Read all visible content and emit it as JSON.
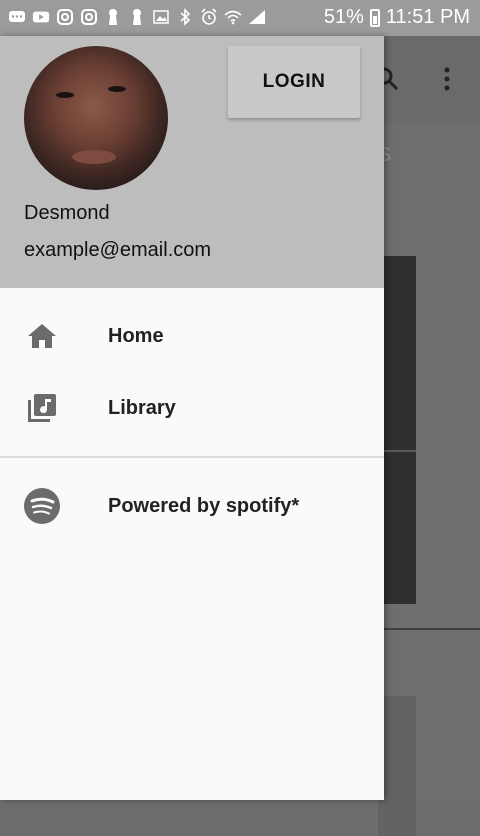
{
  "status_bar": {
    "battery": "51%",
    "time": "11:51 PM"
  },
  "drawer": {
    "login_label": "LOGIN",
    "user_name": "Desmond",
    "user_email": "example@email.com",
    "items": [
      {
        "label": "Home",
        "icon": "home-icon"
      },
      {
        "label": "Library",
        "icon": "library-music-icon"
      }
    ],
    "footer_item": {
      "label": "Powered by spotify*",
      "icon": "spotify-icon"
    }
  },
  "background": {
    "tab_fragment": "S"
  },
  "colors": {
    "header_bg": "#bdbdbd",
    "drawer_bg": "#fafafa",
    "status_bar": "#9b9b9b",
    "scrim": "#6e6e6e"
  }
}
